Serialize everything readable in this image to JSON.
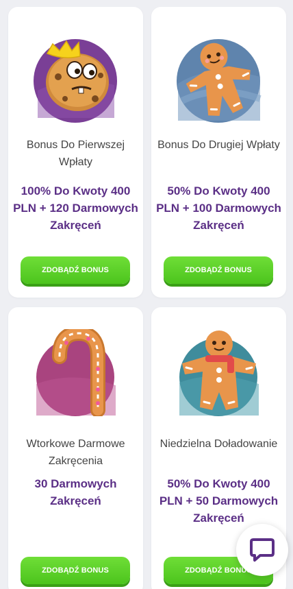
{
  "colors": {
    "background": "#eeeff3",
    "card": "#ffffff",
    "offer_text": "#5b2f86",
    "button": "#4cc41d",
    "chat_icon": "#5b2f86"
  },
  "bonuses": [
    {
      "title": "Bonus Do Pierwszej Wpłaty",
      "offer": "100% Do Kwoty 400 PLN + 120 Darmowych Zakręceń",
      "button": "ZDOBĄDŹ BONUS",
      "icon": "crowned-cookie-icon"
    },
    {
      "title": "Bonus Do Drugiej Wpłaty",
      "offer": "50% Do Kwoty 400 PLN + 100 Darmowych Zakręceń",
      "button": "ZDOBĄDŹ BONUS",
      "icon": "gingerbread-man-icon"
    },
    {
      "title": "Wtorkowe Darmowe Zakręcenia",
      "offer": "30 Darmowych Zakręceń",
      "button": "ZDOBĄDŹ BONUS",
      "icon": "candy-cane-icon"
    },
    {
      "title": "Niedzielna Doładowanie",
      "offer": "50% Do Kwoty 400 PLN + 50 Darmowych Zakręceń",
      "button": "ZDOBĄDŹ BONUS",
      "icon": "gingerbread-scarf-icon"
    }
  ],
  "chat": {
    "icon": "chat-bubble-icon"
  }
}
